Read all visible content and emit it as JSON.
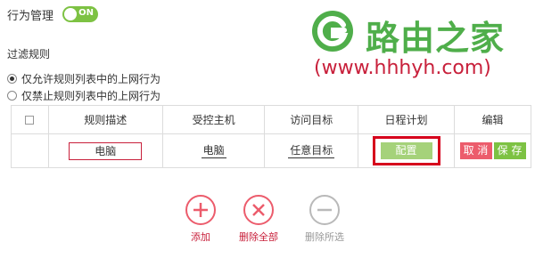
{
  "header": {
    "title": "行为管理",
    "toggle_label": "ON",
    "toggle_on": true
  },
  "watermark": {
    "name": "路由之家",
    "url": "(www.hhhyh.com)"
  },
  "filter": {
    "section_title": "过滤规则",
    "options": [
      {
        "label": "仅允许规则列表中的上网行为",
        "selected": true
      },
      {
        "label": "仅禁止规则列表中的上网行为",
        "selected": false
      }
    ]
  },
  "table": {
    "headers": [
      "规则描述",
      "受控主机",
      "访问目标",
      "日程计划",
      "编辑"
    ],
    "row": {
      "description": "电脑",
      "host": "电脑",
      "target": "任意目标",
      "schedule_button": "配置",
      "cancel_button": "取 消",
      "save_button": "保 存"
    }
  },
  "actions": {
    "add": "添加",
    "delete_all": "删除全部",
    "delete_selected": "删除所选"
  },
  "colors": {
    "accent_green": "#7dc243",
    "accent_red": "#ec5c6c",
    "highlight_red": "#d6001c",
    "watermark_green": "#4fae4a",
    "watermark_red": "#c8203b"
  }
}
